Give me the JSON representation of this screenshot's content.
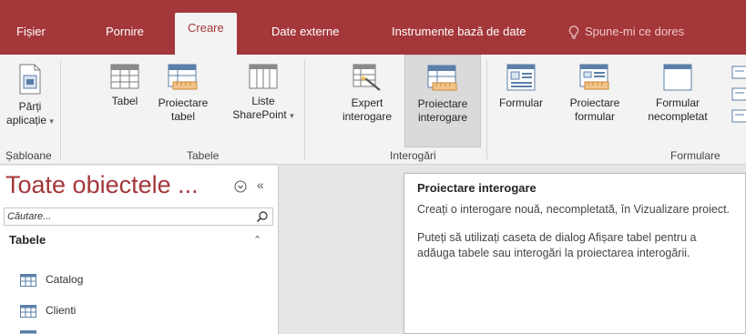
{
  "tabs": [
    {
      "label": "Fișier"
    },
    {
      "label": "Pornire"
    },
    {
      "label": "Creare"
    },
    {
      "label": "Date externe"
    },
    {
      "label": "Instrumente bază de date"
    }
  ],
  "tell_me": "Spune-mi ce dores",
  "ribbon": {
    "parti_aplicatie": {
      "line1": "Părți",
      "line2": "aplicație"
    },
    "tabel": {
      "line1": "Tabel"
    },
    "proiectare_tabel": {
      "line1": "Proiectare",
      "line2": "tabel"
    },
    "liste_sharepoint": {
      "line1": "Liste",
      "line2": "SharePoint"
    },
    "expert_interogare": {
      "line1": "Expert",
      "line2": "interogare"
    },
    "proiectare_interogare": {
      "line1": "Proiectare",
      "line2": "interogare"
    },
    "formular": {
      "line1": "Formular"
    },
    "proiectare_formular": {
      "line1": "Proiectare",
      "line2": "formular"
    },
    "formular_necompletat": {
      "line1": "Formular",
      "line2": "necompletat"
    },
    "groups": {
      "sabloane": "Șabloane",
      "tabele": "Tabele",
      "interogari": "Interogări",
      "formulare": "Formulare"
    }
  },
  "nav": {
    "title": "Toate obiectele ...",
    "search_placeholder": "Căutare...",
    "group": "Tabele",
    "items": [
      {
        "label": "Catalog"
      },
      {
        "label": "Clienti"
      }
    ]
  },
  "tooltip": {
    "title": "Proiectare interogare",
    "p1": "Creați o interogare nouă, necompletată, în Vizualizare proiect.",
    "p2": "Puteți să utilizați caseta de dialog Afișare tabel pentru a adăuga tabele sau interogări la proiectarea interogării."
  },
  "colors": {
    "accent": "#a4373a",
    "ribbon_bg": "#f3f3f3",
    "tooltip_bg": "#ffffff"
  }
}
